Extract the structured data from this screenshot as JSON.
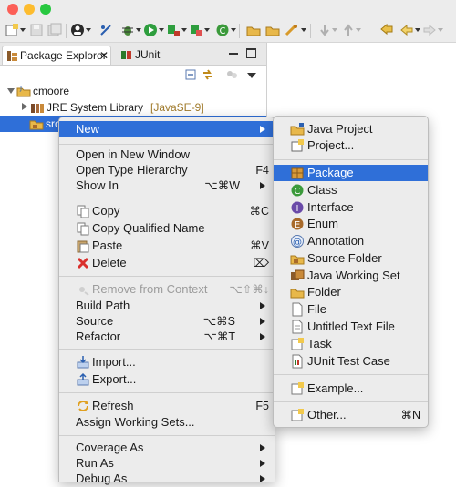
{
  "view": {
    "tabs": [
      {
        "label": "Package Explorer"
      },
      {
        "label": "JUnit"
      }
    ],
    "tree": {
      "project": "cmoore",
      "library": "JRE System Library",
      "library_suffix": "[JavaSE-9]",
      "src": "src"
    }
  },
  "context_menu": {
    "items": [
      {
        "label": "New",
        "shortcut": "",
        "submenu": true
      },
      {
        "label": "Open in New Window",
        "shortcut": ""
      },
      {
        "label": "Open Type Hierarchy",
        "shortcut": "F4"
      },
      {
        "label": "Show In",
        "shortcut": "⌥⌘W",
        "submenu": true
      },
      {
        "label": "Copy",
        "shortcut": "⌘C"
      },
      {
        "label": "Copy Qualified Name",
        "shortcut": ""
      },
      {
        "label": "Paste",
        "shortcut": "⌘V"
      },
      {
        "label": "Delete",
        "shortcut": "⌦"
      },
      {
        "label": "Remove from Context",
        "shortcut": "⌥⇧⌘↓"
      },
      {
        "label": "Build Path",
        "shortcut": "",
        "submenu": true
      },
      {
        "label": "Source",
        "shortcut": "⌥⌘S",
        "submenu": true
      },
      {
        "label": "Refactor",
        "shortcut": "⌥⌘T",
        "submenu": true
      },
      {
        "label": "Import...",
        "shortcut": ""
      },
      {
        "label": "Export...",
        "shortcut": ""
      },
      {
        "label": "Refresh",
        "shortcut": "F5"
      },
      {
        "label": "Assign Working Sets...",
        "shortcut": ""
      },
      {
        "label": "Coverage As",
        "shortcut": "",
        "submenu": true
      },
      {
        "label": "Run As",
        "shortcut": "",
        "submenu": true
      },
      {
        "label": "Debug As",
        "shortcut": "",
        "submenu": true
      }
    ]
  },
  "new_submenu": {
    "items": [
      {
        "label": "Java Project",
        "shortcut": ""
      },
      {
        "label": "Project...",
        "shortcut": ""
      },
      {
        "label": "Package",
        "shortcut": ""
      },
      {
        "label": "Class",
        "shortcut": ""
      },
      {
        "label": "Interface",
        "shortcut": ""
      },
      {
        "label": "Enum",
        "shortcut": ""
      },
      {
        "label": "Annotation",
        "shortcut": ""
      },
      {
        "label": "Source Folder",
        "shortcut": ""
      },
      {
        "label": "Java Working Set",
        "shortcut": ""
      },
      {
        "label": "Folder",
        "shortcut": ""
      },
      {
        "label": "File",
        "shortcut": ""
      },
      {
        "label": "Untitled Text File",
        "shortcut": ""
      },
      {
        "label": "Task",
        "shortcut": ""
      },
      {
        "label": "JUnit Test Case",
        "shortcut": ""
      },
      {
        "label": "Example...",
        "shortcut": ""
      },
      {
        "label": "Other...",
        "shortcut": "⌘N"
      }
    ]
  },
  "colors": {
    "selection": "#2f6fd8",
    "menu_bg": "#ececec",
    "close_red": "#fc5f57",
    "minimize_yellow": "#fdbc2e",
    "zoom_green": "#28c840",
    "library_suffix": "#a07a2a"
  },
  "icons": {
    "toolbar": [
      "new-wizard-icon",
      "save-icon",
      "save-all-icon",
      "profile-icon",
      "skip-breakpoints-icon",
      "debug-icon",
      "run-icon",
      "external-tools-icon",
      "coverage-icon",
      "new-java-package-icon",
      "open-type-icon",
      "search-icon",
      "next-annotation-icon",
      "previous-annotation-icon",
      "back-icon",
      "forward-icon"
    ],
    "view": [
      "collapse-all-icon",
      "link-with-editor-icon",
      "focus-icon",
      "view-menu-icon",
      "minimize-icon",
      "maximize-icon"
    ]
  }
}
